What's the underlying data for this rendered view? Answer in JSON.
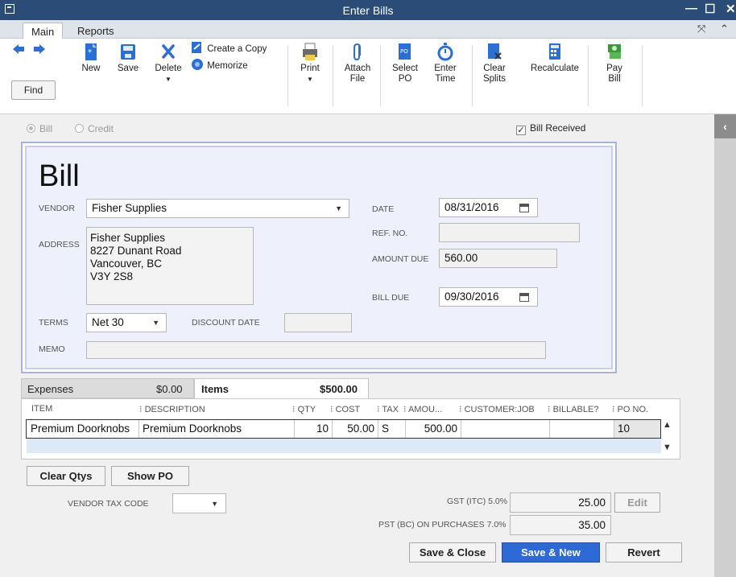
{
  "window": {
    "title": "Enter Bills"
  },
  "tabs": [
    {
      "label": "Main",
      "active": true
    },
    {
      "label": "Reports",
      "active": false
    }
  ],
  "toolbar": {
    "find": "Find",
    "new": "New",
    "save": "Save",
    "delete": "Delete",
    "create_copy": "Create a Copy",
    "memorize": "Memorize",
    "print": "Print",
    "attach_file_1": "Attach",
    "attach_file_2": "File",
    "select_po_1": "Select",
    "select_po_2": "PO",
    "enter_time_1": "Enter",
    "enter_time_2": "Time",
    "clear_splits_1": "Clear",
    "clear_splits_2": "Splits",
    "recalculate": "Recalculate",
    "pay_bill_1": "Pay",
    "pay_bill_2": "Bill"
  },
  "mode": {
    "bill": "Bill",
    "credit": "Credit",
    "bill_received": "Bill Received"
  },
  "form": {
    "heading": "Bill",
    "vendor_label": "VENDOR",
    "vendor": "Fisher Supplies",
    "address_label": "ADDRESS",
    "address": [
      "Fisher Supplies",
      "8227 Dunant Road",
      "Vancouver, BC",
      "V3Y 2S8"
    ],
    "date_label": "DATE",
    "date": "08/31/2016",
    "ref_label": "REF. NO.",
    "ref": "",
    "amount_due_label": "AMOUNT DUE",
    "amount_due": "560.00",
    "bill_due_label": "BILL DUE",
    "bill_due": "09/30/2016",
    "terms_label": "TERMS",
    "terms": "Net 30",
    "discount_date_label": "DISCOUNT DATE",
    "discount_date": "",
    "memo_label": "MEMO",
    "memo": ""
  },
  "grid": {
    "tabs": {
      "expenses_label": "Expenses",
      "expenses_amount": "$0.00",
      "items_label": "Items",
      "items_amount": "$500.00"
    },
    "columns": [
      "ITEM",
      "DESCRIPTION",
      "QTY",
      "COST",
      "TAX",
      "AMOU...",
      "CUSTOMER:JOB",
      "BILLABLE?",
      "PO NO."
    ],
    "rows": [
      {
        "item": "Premium Doorknobs",
        "description": "Premium Doorknobs",
        "qty": "10",
        "cost": "50.00",
        "tax": "S",
        "amount": "500.00",
        "customer_job": "",
        "billable": "",
        "po_no": "10"
      }
    ]
  },
  "grid_buttons": {
    "clear_qtys": "Clear Qtys",
    "show_po": "Show PO"
  },
  "tax": {
    "vendor_tax_code_label": "VENDOR TAX CODE",
    "vendor_tax_code": "",
    "gst_label": "GST (ITC) 5.0%",
    "gst": "25.00",
    "pst_label": "PST (BC) ON PURCHASES 7.0%",
    "pst": "35.00",
    "edit": "Edit"
  },
  "footer": {
    "save_close": "Save & Close",
    "save_new": "Save & New",
    "revert": "Revert"
  },
  "colors": {
    "titlebar": "#2a4c77",
    "primary_button": "#2d6ad6",
    "form_border": "#a9b3d9"
  }
}
